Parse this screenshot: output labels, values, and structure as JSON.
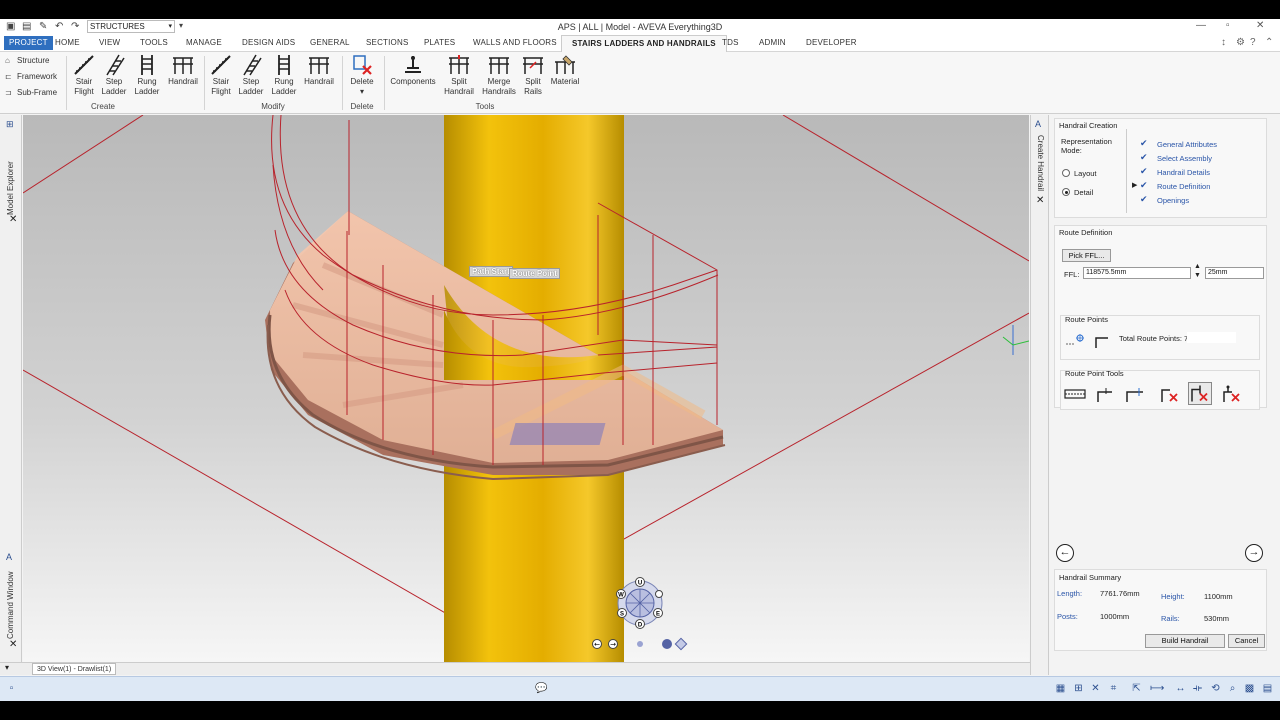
{
  "titlebar": {
    "quick_access_value": "STRUCTURES",
    "window_title": "APS | ALL | Model - AVEVA Everything3D"
  },
  "tabs": [
    {
      "label": "PROJECT"
    },
    {
      "label": "HOME"
    },
    {
      "label": "VIEW"
    },
    {
      "label": "TOOLS"
    },
    {
      "label": "MANAGE"
    },
    {
      "label": "DESIGN AIDS"
    },
    {
      "label": "GENERAL"
    },
    {
      "label": "SECTIONS"
    },
    {
      "label": "PLATES"
    },
    {
      "label": "WALLS AND FLOORS"
    },
    {
      "label": "STAIRS LADDERS AND HANDRAILS"
    },
    {
      "label": "TDS"
    },
    {
      "label": "ADMIN"
    },
    {
      "label": "DEVELOPER"
    }
  ],
  "ribbon": {
    "side_items": [
      {
        "label": "Structure",
        "icon": "structure-icon"
      },
      {
        "label": "Framework",
        "icon": "framework-icon"
      },
      {
        "label": "Sub-Frame",
        "icon": "subframe-icon"
      }
    ],
    "create": {
      "label": "Create",
      "buttons": [
        {
          "line1": "Stair",
          "line2": "Flight"
        },
        {
          "line1": "Step",
          "line2": "Ladder"
        },
        {
          "line1": "Rung",
          "line2": "Ladder"
        },
        {
          "line1": "Handrail",
          "line2": ""
        }
      ]
    },
    "modify": {
      "label": "Modify",
      "buttons": [
        {
          "line1": "Stair",
          "line2": "Flight"
        },
        {
          "line1": "Step",
          "line2": "Ladder"
        },
        {
          "line1": "Rung",
          "line2": "Ladder"
        },
        {
          "line1": "Handrail",
          "line2": ""
        }
      ]
    },
    "delete": {
      "label": "Delete",
      "button": "Delete"
    },
    "tools": {
      "label": "Tools",
      "buttons": [
        {
          "line1": "Components",
          "line2": ""
        },
        {
          "line1": "Split",
          "line2": "Handrail"
        },
        {
          "line1": "Merge",
          "line2": "Handrails"
        },
        {
          "line1": "Split",
          "line2": "Rails"
        },
        {
          "line1": "Material",
          "line2": ""
        }
      ]
    }
  },
  "left_panels": {
    "model_explorer": "Model Explorer",
    "command_window": "Command Window"
  },
  "right_strip": {
    "create_handrail": "Create Handrail"
  },
  "viewport": {
    "tag_path_start": "Path Start",
    "tag_route_point": "Route Point",
    "view_tab": "3D View(1) - Drawlist(1)",
    "compass": {
      "n": "U",
      "s": "D",
      "e": "E",
      "w": "W",
      "se": "S"
    }
  },
  "panel": {
    "creation_title": "Handrail Creation",
    "representation_label": "Representation Mode:",
    "mode_layout": "Layout",
    "mode_detail": "Detail",
    "steps": [
      {
        "label": "General Attributes"
      },
      {
        "label": "Select Assembly"
      },
      {
        "label": "Handrail Details"
      },
      {
        "label": "Route Definition"
      },
      {
        "label": "Openings"
      }
    ],
    "route_definition_title": "Route Definition",
    "pick_ffl_button": "Pick FFL...",
    "ffl_label": "FFL:",
    "ffl_value": "118575.5mm",
    "ffl_offset": "25mm",
    "route_points_title": "Route Points",
    "total_route_points": "Total Route Points: 7",
    "route_point_tools_title": "Route Point Tools",
    "summary": {
      "title": "Handrail Summary",
      "length_label": "Length:",
      "length_value": "7761.76mm",
      "height_label": "Height:",
      "height_value": "1100mm",
      "posts_label": "Posts:",
      "posts_value": "1000mm",
      "rails_label": "Rails:",
      "rails_value": "530mm"
    },
    "build_button": "Build Handrail",
    "cancel_button": "Cancel"
  }
}
